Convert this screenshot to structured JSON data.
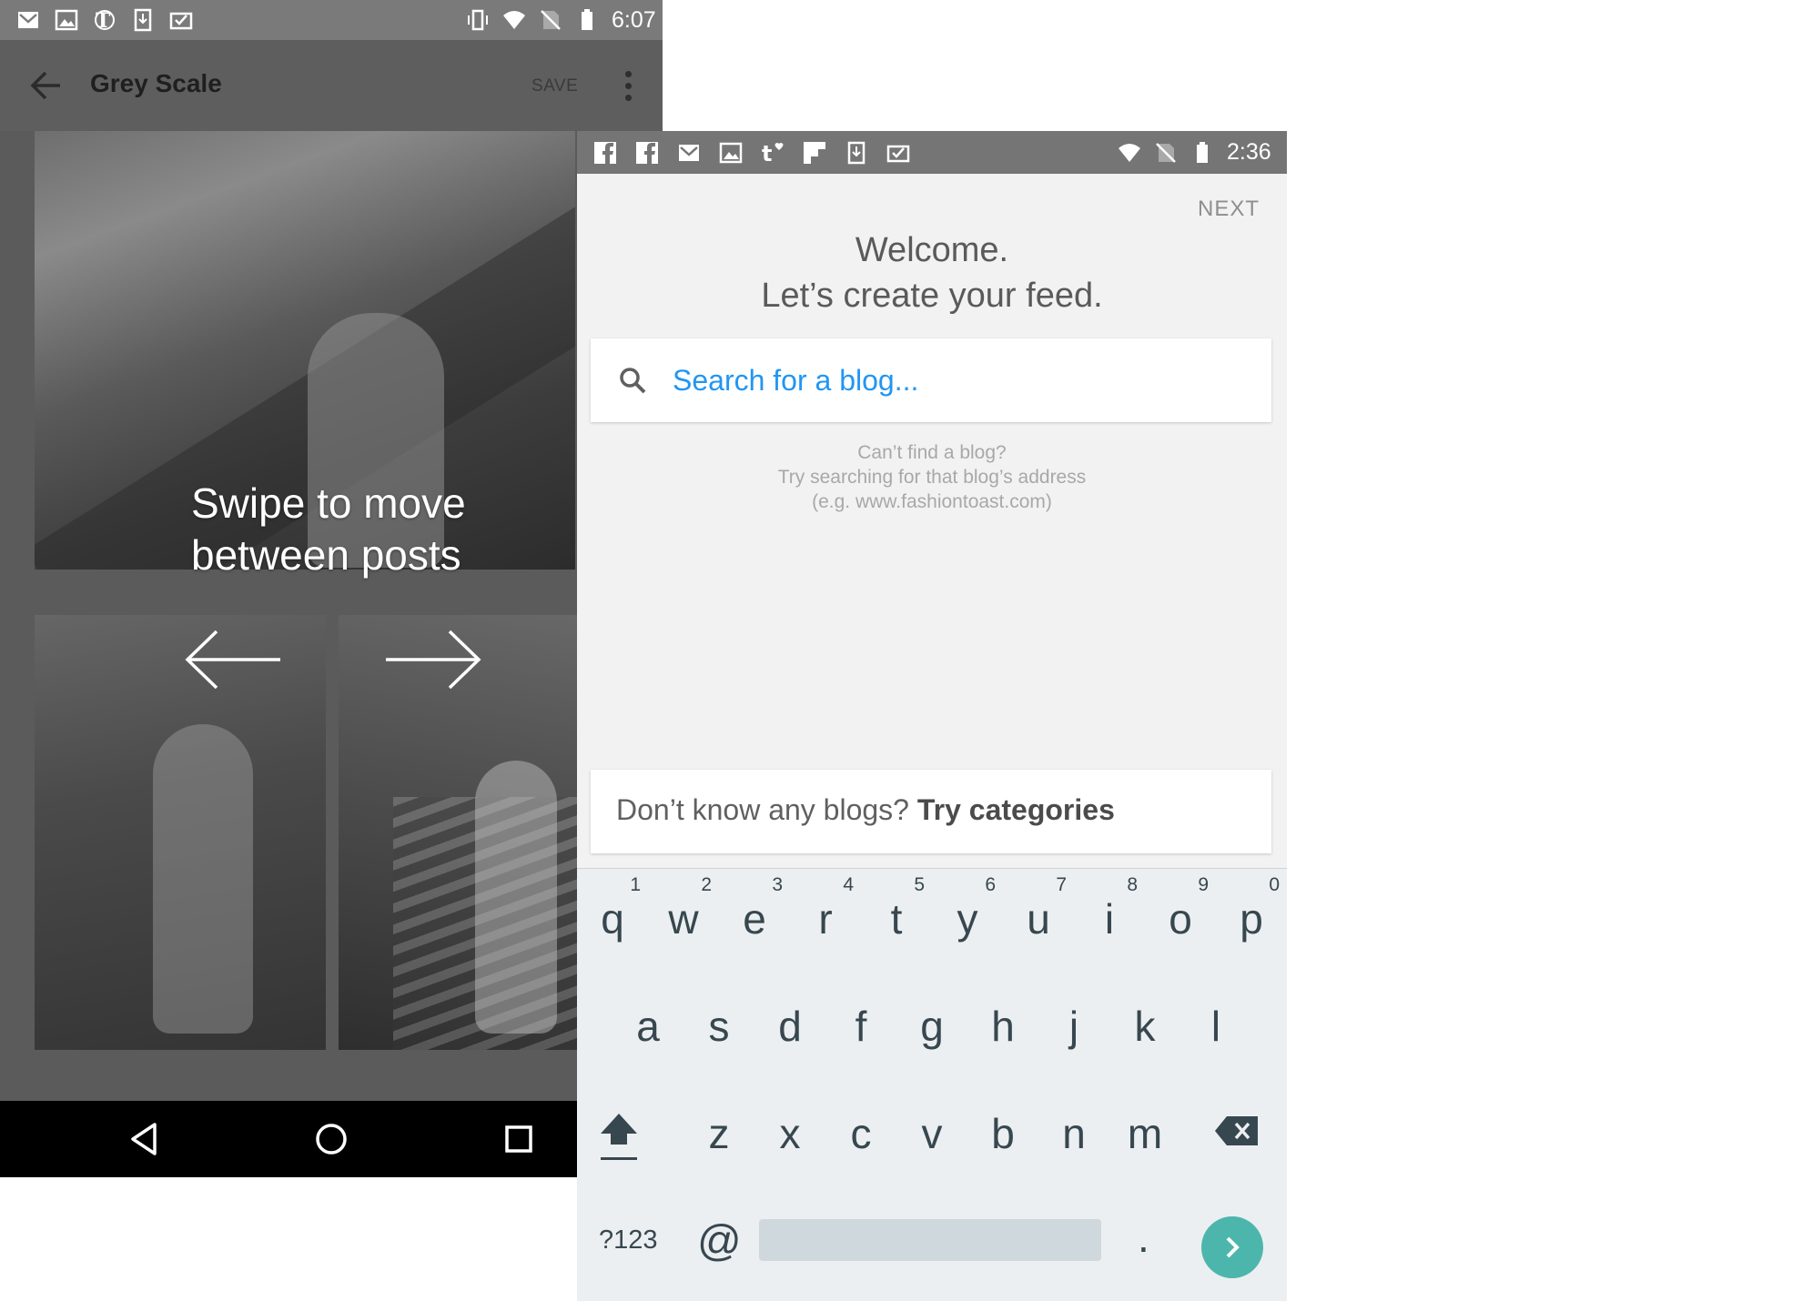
{
  "left_phone": {
    "status_bar": {
      "time": "6:07",
      "icons": [
        "gmail-icon",
        "photos-icon",
        "nyt-icon",
        "download-icon",
        "clipboard-check-icon"
      ],
      "right_icons": [
        "vibrate-icon",
        "wifi-icon",
        "no-sim-icon",
        "battery-icon"
      ]
    },
    "toolbar": {
      "back_icon": "arrow-left-icon",
      "title": "Grey Scale",
      "save_label": "SAVE",
      "more_icon": "more-vert-icon"
    },
    "tutorial": {
      "line1": "Swipe to move",
      "line2": "between posts",
      "left_arrow_icon": "arrow-left-icon",
      "right_arrow_icon": "arrow-right-icon"
    },
    "nav_bar": [
      "back-triangle-icon",
      "home-circle-icon",
      "recents-square-icon"
    ]
  },
  "right_phone": {
    "status_bar": {
      "time": "2:36",
      "icons": [
        "facebook-icon",
        "facebook-icon",
        "gmail-icon",
        "photos-icon",
        "tumblr-icon",
        "flipboard-icon",
        "download-icon",
        "clipboard-check-icon"
      ],
      "right_icons": [
        "wifi-icon",
        "no-sim-icon",
        "battery-icon"
      ]
    },
    "next_label": "NEXT",
    "welcome_line1": "Welcome.",
    "welcome_line2": "Let’s create your feed.",
    "search": {
      "placeholder": "Search for a blog...",
      "value": ""
    },
    "hint": {
      "line1": "Can’t find a blog?",
      "line2": "Try searching for that blog’s address",
      "line3": "(e.g. www.fashiontoast.com)"
    },
    "categories": {
      "prefix": "Don’t know any blogs?",
      "link": "Try categories"
    },
    "keyboard": {
      "row1": [
        {
          "ch": "q",
          "num": "1"
        },
        {
          "ch": "w",
          "num": "2"
        },
        {
          "ch": "e",
          "num": "3"
        },
        {
          "ch": "r",
          "num": "4"
        },
        {
          "ch": "t",
          "num": "5"
        },
        {
          "ch": "y",
          "num": "6"
        },
        {
          "ch": "u",
          "num": "7"
        },
        {
          "ch": "i",
          "num": "8"
        },
        {
          "ch": "o",
          "num": "9"
        },
        {
          "ch": "p",
          "num": "0"
        }
      ],
      "row2": [
        "a",
        "s",
        "d",
        "f",
        "g",
        "h",
        "j",
        "k",
        "l"
      ],
      "row3": [
        "z",
        "x",
        "c",
        "v",
        "b",
        "n",
        "m"
      ],
      "symbols_label": "?123",
      "at_label": "@",
      "period_label": ".",
      "shift_icon": "shift-arrow-icon",
      "backspace_icon": "backspace-icon",
      "enter_icon": "chevron-right-icon",
      "enter_color": "#4db6ac"
    }
  },
  "colors": {
    "accent_blue": "#2196f3",
    "keyboard_bg": "#eceff1",
    "dim_overlay": "#5b5b5b"
  }
}
